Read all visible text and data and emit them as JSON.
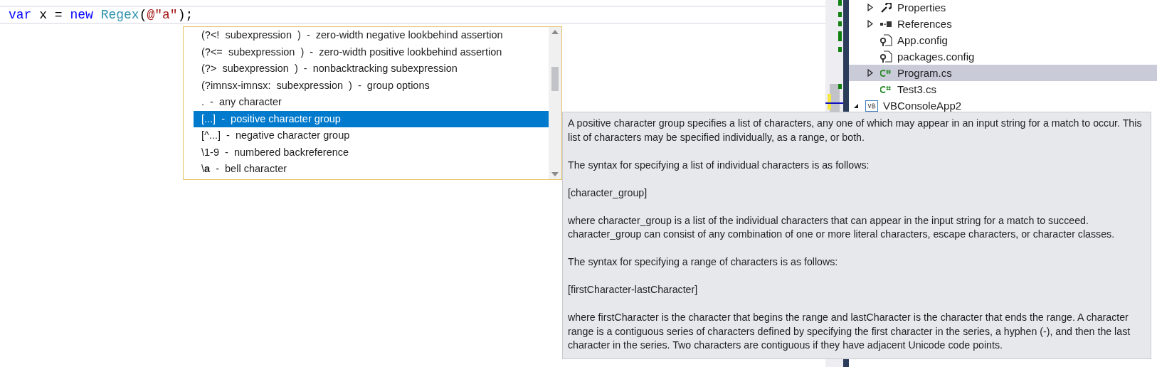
{
  "editor": {
    "code_line": [
      {
        "kind": "keyword",
        "text": "var"
      },
      {
        "kind": "plain",
        "text": " x = "
      },
      {
        "kind": "keyword",
        "text": "new "
      },
      {
        "kind": "type",
        "text": "Regex"
      },
      {
        "kind": "plain",
        "text": "("
      },
      {
        "kind": "string",
        "text": "@\"a\""
      },
      {
        "kind": "plain",
        "text": ");"
      }
    ]
  },
  "completion_list": {
    "items": [
      {
        "text": "(?<!  subexpression  )  -  zero-width negative lookbehind assertion",
        "selected": false
      },
      {
        "text": "(?<=  subexpression  )  -  zero-width positive lookbehind assertion",
        "selected": false
      },
      {
        "text": "(?>  subexpression  )  -  nonbacktracking subexpression",
        "selected": false
      },
      {
        "text": "(?imnsx-imnsx:  subexpression  )  -  group options",
        "selected": false
      },
      {
        "text": ".  -  any character",
        "selected": false
      },
      {
        "text": "[...]  -  positive character group",
        "selected": true
      },
      {
        "text": "[^...]  -  negative character group",
        "selected": false
      },
      {
        "text": "\\1-9  -  numbered backreference",
        "selected": false
      },
      {
        "text": "\\**a**  -  bell character",
        "selected": false
      }
    ]
  },
  "tooltip": {
    "paragraphs": [
      "A positive character group specifies a list of characters, any one of which may appear in an input string for a match to occur. This list of characters may be specified individually, as a range, or both.",
      "The syntax for specifying a list of individual characters is as follows:",
      "[character_group]",
      "where character_group is a list of the individual characters that can appear in the input string for a match to succeed. character_group can consist of any combination of one or more literal characters, escape characters, or character classes.",
      "The syntax for specifying a range of characters is as follows:",
      "[firstCharacter-lastCharacter]",
      "where firstCharacter is the character that begins the range and lastCharacter is the character that ends the range. A character range is a contiguous series of characters defined by specifying the first character in the series, a hyphen (-), and then the last character in the series. Two characters are contiguous if they have adjacent Unicode code points."
    ]
  },
  "solution_tree": [
    {
      "children": [
        {
          "label": "Properties",
          "kind": "properties",
          "expanded": false,
          "selected": false
        },
        {
          "label": "References",
          "kind": "references",
          "expanded": false,
          "selected": false
        },
        {
          "label": "App.config",
          "kind": "config",
          "selected": false
        },
        {
          "label": "packages.config",
          "kind": "config",
          "selected": false
        },
        {
          "label": "Program.cs",
          "kind": "csharp",
          "expanded": false,
          "selected": true
        },
        {
          "label": "Test3.cs",
          "kind": "csharp",
          "selected": false
        }
      ]
    },
    {
      "label": "VBConsoleApp2",
      "kind": "vb-project",
      "expanded": true,
      "selected": false
    }
  ]
}
